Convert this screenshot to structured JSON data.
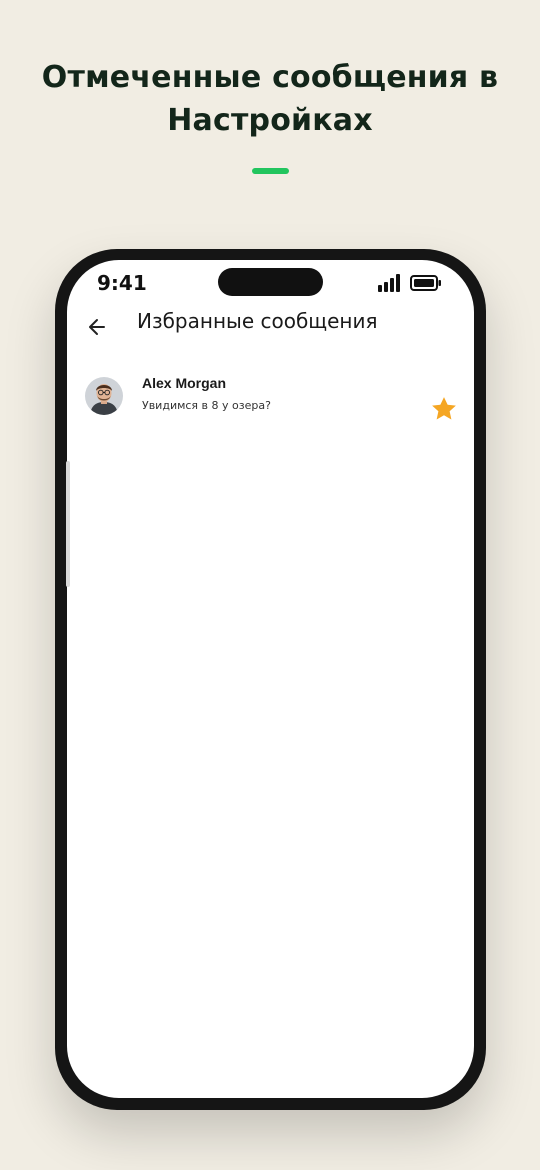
{
  "promo": {
    "title_line1": "Отмеченные сообщения в",
    "title_line2": "Настройках",
    "accent_color": "#22c55e",
    "background_color": "#f1ede3"
  },
  "status_bar": {
    "time": "9:41",
    "signal_icon": "cellular-signal-icon",
    "battery_icon": "battery-icon"
  },
  "header": {
    "back_icon": "arrow-left-icon",
    "title": "Избранные сообщения"
  },
  "messages": [
    {
      "sender": "Alex Morgan",
      "text": "Увидимся в 8 у озера?",
      "starred": true,
      "star_color": "#f5a623",
      "avatar_icon": "user-avatar"
    }
  ]
}
